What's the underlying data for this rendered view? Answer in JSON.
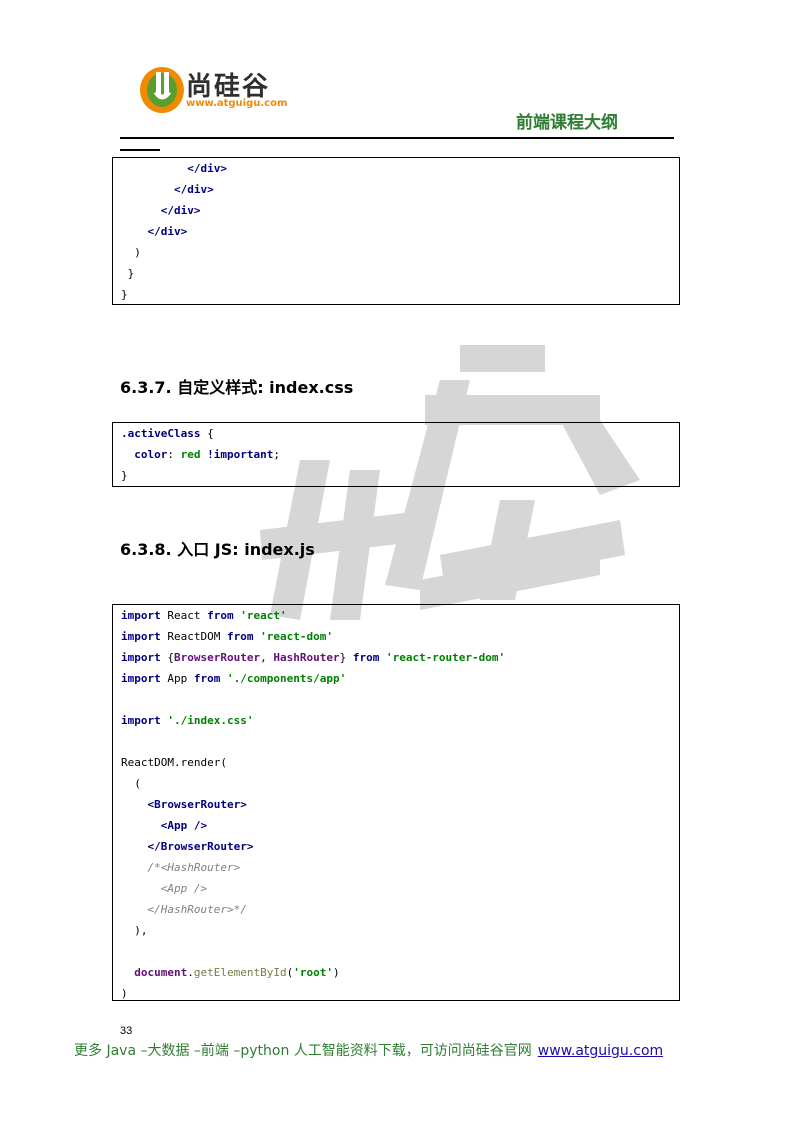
{
  "header": {
    "logo_text": "尚硅谷",
    "logo_url": "www.atguigu.com",
    "title": "前端课程大纲"
  },
  "code_block_1": {
    "lines": [
      {
        "indent": "          ",
        "parts": [
          {
            "t": "</",
            "c": "tag"
          },
          {
            "t": "div",
            "c": "tag"
          },
          {
            "t": ">",
            "c": "tag"
          }
        ]
      },
      {
        "indent": "        ",
        "parts": [
          {
            "t": "</div>",
            "c": "tag"
          }
        ]
      },
      {
        "indent": "      ",
        "parts": [
          {
            "t": "</div>",
            "c": "tag"
          }
        ]
      },
      {
        "indent": "    ",
        "parts": [
          {
            "t": "</div>",
            "c": "tag"
          }
        ]
      },
      {
        "indent": "  ",
        "parts": [
          {
            "t": ")",
            "c": "plain"
          }
        ]
      },
      {
        "indent": " ",
        "parts": [
          {
            "t": "}",
            "c": "plain"
          }
        ]
      },
      {
        "indent": "",
        "parts": [
          {
            "t": "}",
            "c": "plain"
          }
        ]
      }
    ]
  },
  "section_637": {
    "heading": "6.3.7.  自定义样式: index.css"
  },
  "code_block_2": {
    "lines": [
      {
        "indent": "",
        "parts": [
          {
            "t": ".activeClass",
            "c": "kw"
          },
          {
            "t": " {",
            "c": "plain"
          }
        ]
      },
      {
        "indent": "  ",
        "parts": [
          {
            "t": "color",
            "c": "kw"
          },
          {
            "t": ": ",
            "c": "plain"
          },
          {
            "t": "red",
            "c": "str"
          },
          {
            "t": " ",
            "c": "plain"
          },
          {
            "t": "!important",
            "c": "kw"
          },
          {
            "t": ";",
            "c": "plain"
          }
        ]
      },
      {
        "indent": "",
        "parts": [
          {
            "t": "}",
            "c": "plain"
          }
        ]
      }
    ]
  },
  "section_638": {
    "heading": "6.3.8.  入口 JS: index.js"
  },
  "code_block_3": {
    "lines": [
      {
        "indent": "",
        "parts": [
          {
            "t": "import",
            "c": "kw"
          },
          {
            "t": " React ",
            "c": "plain"
          },
          {
            "t": "from",
            "c": "kw"
          },
          {
            "t": " ",
            "c": "plain"
          },
          {
            "t": "'react'",
            "c": "str"
          }
        ]
      },
      {
        "indent": "",
        "parts": [
          {
            "t": "import",
            "c": "kw"
          },
          {
            "t": " ReactDOM ",
            "c": "plain"
          },
          {
            "t": "from",
            "c": "kw"
          },
          {
            "t": " ",
            "c": "plain"
          },
          {
            "t": "'react-dom'",
            "c": "str"
          }
        ]
      },
      {
        "indent": "",
        "parts": [
          {
            "t": "import",
            "c": "kw"
          },
          {
            "t": " {",
            "c": "plain"
          },
          {
            "t": "BrowserRouter",
            "c": "purple"
          },
          {
            "t": ", ",
            "c": "plain"
          },
          {
            "t": "HashRouter",
            "c": "purple"
          },
          {
            "t": "} ",
            "c": "plain"
          },
          {
            "t": "from",
            "c": "kw"
          },
          {
            "t": " ",
            "c": "plain"
          },
          {
            "t": "'react-router-dom'",
            "c": "str"
          }
        ]
      },
      {
        "indent": "",
        "parts": [
          {
            "t": "import",
            "c": "kw"
          },
          {
            "t": " App ",
            "c": "plain"
          },
          {
            "t": "from",
            "c": "kw"
          },
          {
            "t": " ",
            "c": "plain"
          },
          {
            "t": "'./components/app'",
            "c": "str"
          }
        ]
      },
      {
        "indent": "",
        "parts": []
      },
      {
        "indent": "",
        "parts": [
          {
            "t": "import",
            "c": "kw"
          },
          {
            "t": " ",
            "c": "plain"
          },
          {
            "t": "'./index.css'",
            "c": "str"
          }
        ]
      },
      {
        "indent": "",
        "parts": []
      },
      {
        "indent": "",
        "parts": [
          {
            "t": "ReactDOM.render(",
            "c": "plain"
          }
        ]
      },
      {
        "indent": "  ",
        "parts": [
          {
            "t": "(",
            "c": "plain"
          }
        ]
      },
      {
        "indent": "    ",
        "parts": [
          {
            "t": "<BrowserRouter>",
            "c": "tag"
          }
        ]
      },
      {
        "indent": "      ",
        "parts": [
          {
            "t": "<App />",
            "c": "tag"
          }
        ]
      },
      {
        "indent": "    ",
        "parts": [
          {
            "t": "</BrowserRouter>",
            "c": "tag"
          }
        ]
      },
      {
        "indent": "    ",
        "parts": [
          {
            "t": "/*<HashRouter>",
            "c": "cmt"
          }
        ]
      },
      {
        "indent": "      ",
        "parts": [
          {
            "t": "<App />",
            "c": "cmt"
          }
        ]
      },
      {
        "indent": "    ",
        "parts": [
          {
            "t": "</HashRouter>*/",
            "c": "cmt"
          }
        ]
      },
      {
        "indent": "  ",
        "parts": [
          {
            "t": "),",
            "c": "plain"
          }
        ]
      },
      {
        "indent": "",
        "parts": []
      },
      {
        "indent": "  ",
        "parts": [
          {
            "t": "document",
            "c": "purple"
          },
          {
            "t": ".",
            "c": "plain"
          },
          {
            "t": "getElementById",
            "c": "fn"
          },
          {
            "t": "(",
            "c": "plain"
          },
          {
            "t": "'root'",
            "c": "str"
          },
          {
            "t": ")",
            "c": "plain"
          }
        ]
      },
      {
        "indent": "",
        "parts": [
          {
            "t": ")",
            "c": "plain"
          }
        ]
      }
    ]
  },
  "footer": {
    "page_number": "33",
    "text": "更多 Java –大数据 –前端 –python 人工智能资料下载，可访问尚硅谷官网",
    "link": "www.atguigu.com"
  },
  "colors": {
    "brand_green": "#2e7d32",
    "logo_orange": "#f08a00",
    "keyword": "#000080",
    "string": "#008000",
    "purple": "#660e7a",
    "comment": "#808080"
  }
}
